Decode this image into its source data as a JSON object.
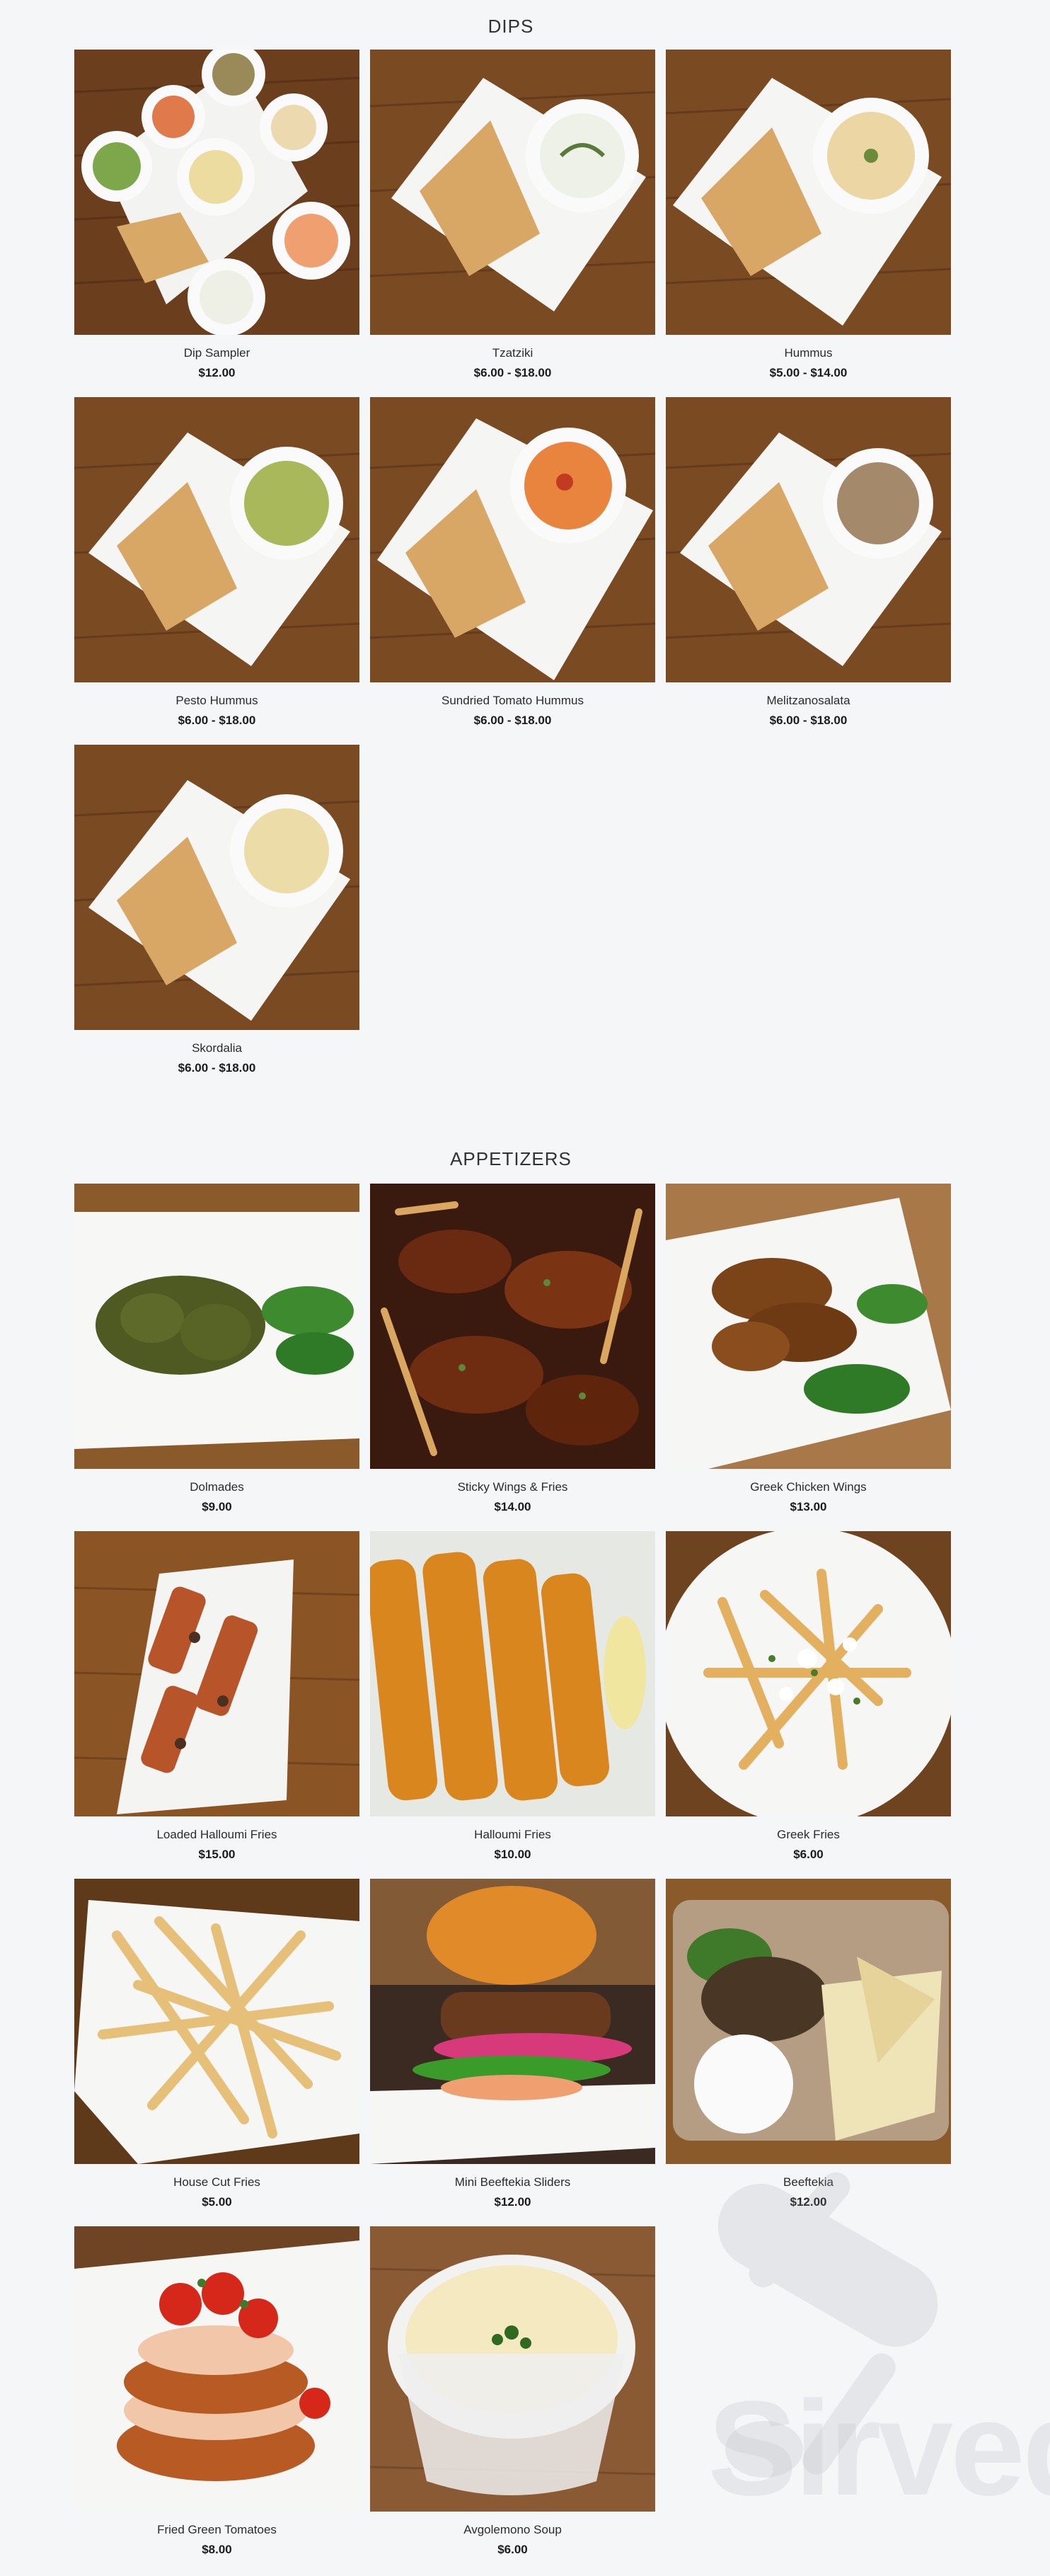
{
  "dips": {
    "title": "DIPS",
    "items": [
      {
        "name": "Dip Sampler",
        "price": "$12.00"
      },
      {
        "name": "Tzatziki",
        "price": "$6.00 - $18.00"
      },
      {
        "name": "Hummus",
        "price": "$5.00 - $14.00"
      },
      {
        "name": "Pesto Hummus",
        "price": "$6.00 - $18.00"
      },
      {
        "name": "Sundried Tomato Hummus",
        "price": "$6.00 - $18.00"
      },
      {
        "name": "Melitzanosalata",
        "price": "$6.00 - $18.00"
      },
      {
        "name": "Skordalia",
        "price": "$6.00 - $18.00"
      }
    ]
  },
  "appetizers": {
    "title": "APPETIZERS",
    "items": [
      {
        "name": "Dolmades",
        "price": "$9.00"
      },
      {
        "name": "Sticky Wings & Fries",
        "price": "$14.00"
      },
      {
        "name": "Greek Chicken Wings",
        "price": "$13.00"
      },
      {
        "name": "Loaded Halloumi Fries",
        "price": "$15.00"
      },
      {
        "name": "Halloumi Fries",
        "price": "$10.00"
      },
      {
        "name": "Greek Fries",
        "price": "$6.00"
      },
      {
        "name": "House Cut Fries",
        "price": "$5.00"
      },
      {
        "name": "Mini Beeftekia Sliders",
        "price": "$12.00"
      },
      {
        "name": "Beeftekia",
        "price": "$12.00"
      },
      {
        "name": "Fried Green Tomatoes",
        "price": "$8.00"
      },
      {
        "name": "Avgolemono Soup",
        "price": "$6.00"
      }
    ]
  },
  "watermark": {
    "text": "Sirved",
    "icon": "swiss-knife-icon"
  },
  "colors": {
    "background": "#f5f6f8",
    "wood": "#7a4a22",
    "plate": "#f4f4f2"
  }
}
